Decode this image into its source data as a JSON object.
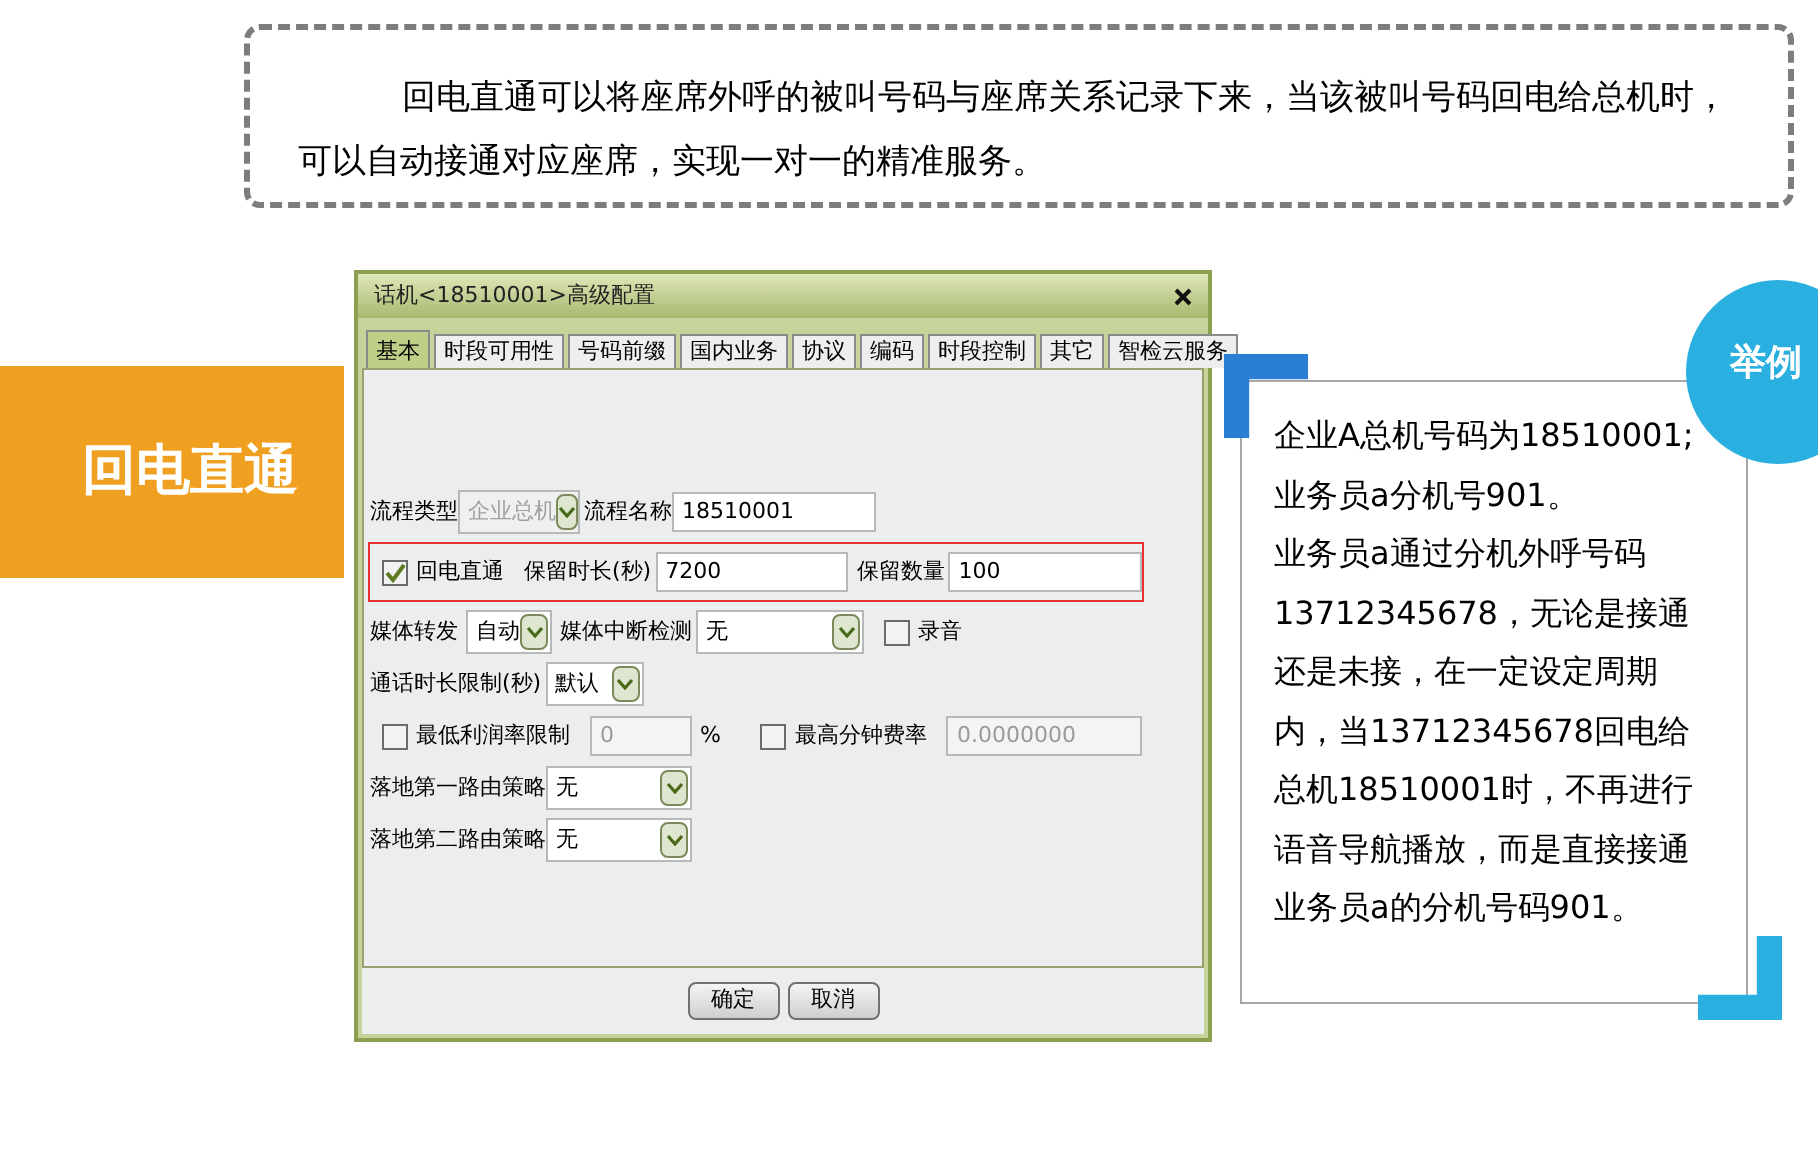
{
  "intro": "回电直通可以将座席外呼的被叫号码与座席关系记录下来，当该被叫号码回电给总机时，可以自动接通对应座席，实现一对一的精准服务。",
  "tag": "回电直通",
  "dialog": {
    "title": "话机<18510001>高级配置",
    "tabs": [
      {
        "label": "基本",
        "selected": true
      },
      {
        "label": "时段可用性",
        "selected": false
      },
      {
        "label": "号码前缀",
        "selected": false
      },
      {
        "label": "国内业务",
        "selected": false
      },
      {
        "label": "协议",
        "selected": false
      },
      {
        "label": "编码",
        "selected": false
      },
      {
        "label": "时段控制",
        "selected": false
      },
      {
        "label": "其它",
        "selected": false
      },
      {
        "label": "智检云服务",
        "selected": false
      }
    ],
    "rows": [
      {
        "highlighted": false,
        "items": [
          {
            "kind": "label",
            "text": "流程类型"
          },
          {
            "kind": "select",
            "value": "企业总机",
            "disabled": true
          },
          {
            "kind": "label",
            "text": "流程名称"
          },
          {
            "kind": "input",
            "value": "18510001",
            "disabled": false
          }
        ]
      },
      {
        "highlighted": true,
        "items": [
          {
            "kind": "checkbox",
            "text": "回电直通",
            "checked": true
          },
          {
            "kind": "label",
            "text": "保留时长(秒)"
          },
          {
            "kind": "input",
            "value": "7200",
            "disabled": false
          },
          {
            "kind": "label",
            "text": "保留数量"
          },
          {
            "kind": "input",
            "value": "100",
            "disabled": false
          }
        ]
      },
      {
        "highlighted": false,
        "items": [
          {
            "kind": "label",
            "text": "媒体转发"
          },
          {
            "kind": "select",
            "value": "自动",
            "disabled": false
          },
          {
            "kind": "label",
            "text": "媒体中断检测"
          },
          {
            "kind": "select",
            "value": "无",
            "disabled": false
          },
          {
            "kind": "checkbox",
            "text": "录音",
            "checked": false
          }
        ]
      },
      {
        "highlighted": false,
        "items": [
          {
            "kind": "label",
            "text": "通话时长限制(秒)"
          },
          {
            "kind": "select",
            "value": "默认",
            "disabled": false
          }
        ]
      },
      {
        "highlighted": false,
        "items": [
          {
            "kind": "checkbox",
            "text": "最低利润率限制",
            "checked": false
          },
          {
            "kind": "input",
            "value": "0",
            "disabled": true
          },
          {
            "kind": "label",
            "text": "%"
          },
          {
            "kind": "checkbox",
            "text": "最高分钟费率",
            "checked": false
          },
          {
            "kind": "input",
            "value": "0.0000000",
            "disabled": true
          }
        ]
      },
      {
        "highlighted": false,
        "items": [
          {
            "kind": "label",
            "text": "落地第一路由策略"
          },
          {
            "kind": "select",
            "value": "无",
            "disabled": false
          }
        ]
      },
      {
        "highlighted": false,
        "items": [
          {
            "kind": "label",
            "text": "落地第二路由策略"
          },
          {
            "kind": "select",
            "value": "无",
            "disabled": false
          }
        ]
      }
    ],
    "buttons": [
      "确定",
      "取消"
    ]
  },
  "example": {
    "badge": "举例",
    "paragraphs": [
      "企业A总机号码为18510001;业务员a分机号901。",
      "业务员a通过分机外呼号码13712345678，无论是接通还是未接，在一定设定周期内，当13712345678回电给总机18510001时，不再进行语音导航播放，而是直接接通业务员a的分机号码901。"
    ]
  }
}
